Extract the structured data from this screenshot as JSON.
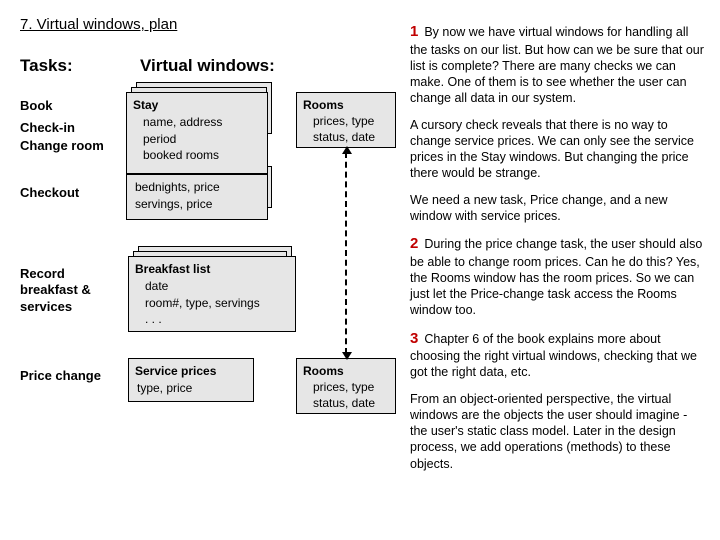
{
  "title": "7. Virtual windows, plan",
  "headings": {
    "tasks": "Tasks:",
    "vw": "Virtual windows:"
  },
  "tasks": {
    "book": "Book",
    "checkin": "Check-in",
    "changeRoom": "Change room",
    "checkout": "Checkout",
    "recordBreakfast": "Record breakfast & services",
    "priceChange": "Price change"
  },
  "boxes": {
    "stay": {
      "title": "Stay",
      "l1": "name, address",
      "l2": "period",
      "l3": "booked rooms"
    },
    "bed": {
      "l1": "bednights, price",
      "l2": "servings, price"
    },
    "bkfst": {
      "title": "Breakfast list",
      "l1": "date",
      "l2": "room#, type, servings",
      "l3": ". . ."
    },
    "srv": {
      "title": "Service prices",
      "l1": "type, price"
    },
    "rooms": {
      "title": "Rooms",
      "l1": "prices, type",
      "l2": "status, date"
    }
  },
  "rcol": {
    "n1": "1",
    "p1a": "By now we have virtual windows for handling all the tasks on our list. But how can we be sure that our list is complete? There are many checks we can make. One of them is to see whether the user can change all data in our system.",
    "p1b": "A cursory check reveals that there is no way to change service prices. We can only see the service prices in the Stay windows. But changing the price there would be strange.",
    "p1c": "We need a new task, Price change, and a new window with service prices.",
    "n2": "2",
    "p2": "During the price change task, the user should also be able to change room prices. Can he do this? Yes, the Rooms window has the room prices. So we can just let the Price-change task access the Rooms window too.",
    "n3": "3",
    "p3a": "Chapter 6 of the book explains more about choosing the right virtual windows, checking that we got the right data, etc.",
    "p3b": "From an object-oriented perspective, the virtual windows are the objects the user should imagine - the user's static class model. Later in the design process, we add operations (methods) to these objects."
  }
}
